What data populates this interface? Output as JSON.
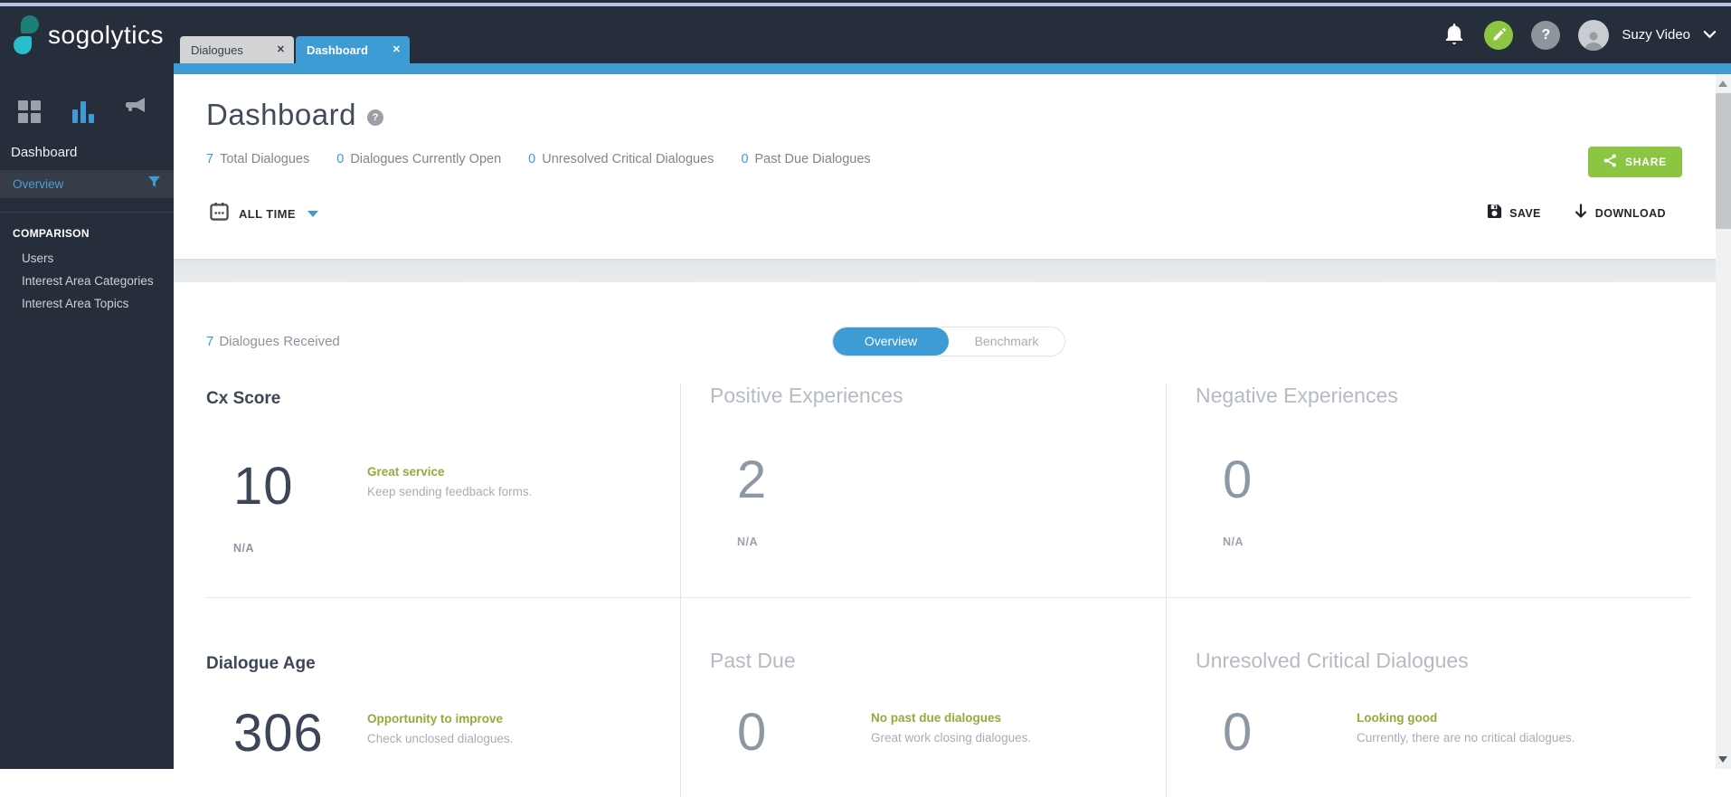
{
  "icons": {
    "close": "✕",
    "question": "?"
  },
  "header": {
    "logo_text": "sogolytics",
    "tabs": [
      {
        "label": "Dialogues"
      },
      {
        "label": "Dashboard"
      }
    ],
    "user_name": "Suzy Video"
  },
  "sidebar": {
    "title": "Dashboard",
    "overview_label": "Overview",
    "section_title": "COMPARISON",
    "items": [
      "Users",
      "Interest Area Categories",
      "Interest Area Topics"
    ]
  },
  "toolbar": {
    "page_title": "Dashboard",
    "stats": [
      {
        "value": "7",
        "label": "Total Dialogues"
      },
      {
        "value": "0",
        "label": "Dialogues Currently Open"
      },
      {
        "value": "0",
        "label": "Unresolved Critical Dialogues"
      },
      {
        "value": "0",
        "label": "Past Due Dialogues"
      }
    ],
    "share_label": "SHARE",
    "time_filter_label": "ALL TIME",
    "save_label": "SAVE",
    "download_label": "DOWNLOAD"
  },
  "section": {
    "received_value": "7",
    "received_label": "Dialogues Received",
    "toggle": {
      "overview": "Overview",
      "benchmark": "Benchmark"
    }
  },
  "cards": [
    {
      "title": "Cx Score",
      "value": "10",
      "status": "Great service",
      "description": "Keep sending feedback forms.",
      "footnote": "N/A"
    },
    {
      "title": "Positive Experiences",
      "value": "2",
      "footnote": "N/A"
    },
    {
      "title": "Negative Experiences",
      "value": "0",
      "footnote": "N/A"
    },
    {
      "title": "Dialogue Age",
      "value": "306",
      "status": "Opportunity to improve",
      "description": "Check unclosed dialogues."
    },
    {
      "title": "Past Due",
      "value": "0",
      "status": "No past due dialogues",
      "description": "Great work closing dialogues."
    },
    {
      "title": "Unresolved Critical Dialogues",
      "value": "0",
      "status": "Looking good",
      "description": "Currently, there are no critical dialogues."
    }
  ],
  "colors": {
    "accent_blue": "#3e9bd4",
    "accent_green": "#8cc541",
    "status_green": "#97a83c",
    "header_bg": "#272e3b"
  }
}
